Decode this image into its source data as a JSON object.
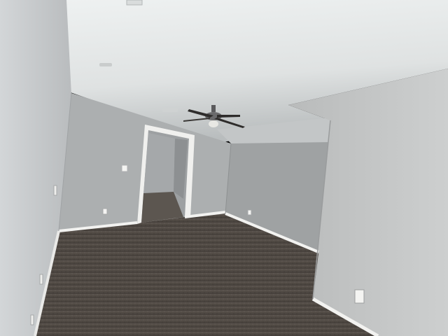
{
  "scene": {
    "subject": "empty-bedroom-interior",
    "features": [
      "ceiling-fan",
      "carpet-floor",
      "open-doorway",
      "electrical-outlets",
      "light-switch",
      "baseboards"
    ],
    "colors": {
      "ceiling": "#e9ecec",
      "ceiling_shadow": "#b8bcbd",
      "wall_left": "#c8cbcd",
      "wall_back": "#a9acad",
      "wall_right": "#c4c6c6",
      "wall_alcove": "#9a9d9e",
      "carpet": "#4e4742",
      "carpet_dark": "#3f3934",
      "trim": "#f2f2f0",
      "fan_metal": "#5a5a5c",
      "fan_blade": "#2e2c2b"
    }
  }
}
